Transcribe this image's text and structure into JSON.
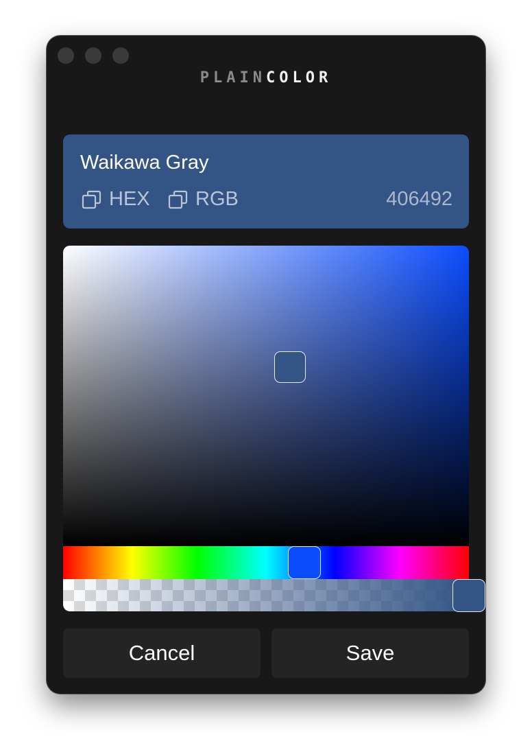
{
  "app": {
    "brand_part1": "PLAIN",
    "brand_part2": "COLOR"
  },
  "color": {
    "name": "Waikawa Gray",
    "hex_value": "406492",
    "swatch_color": "#345486",
    "hue_color": "#0b4dff"
  },
  "copy_buttons": {
    "hex_label": "HEX",
    "rgb_label": "RGB"
  },
  "picker": {
    "hue_position": 0.59,
    "alpha_position": 1.0
  },
  "actions": {
    "cancel_label": "Cancel",
    "save_label": "Save"
  }
}
